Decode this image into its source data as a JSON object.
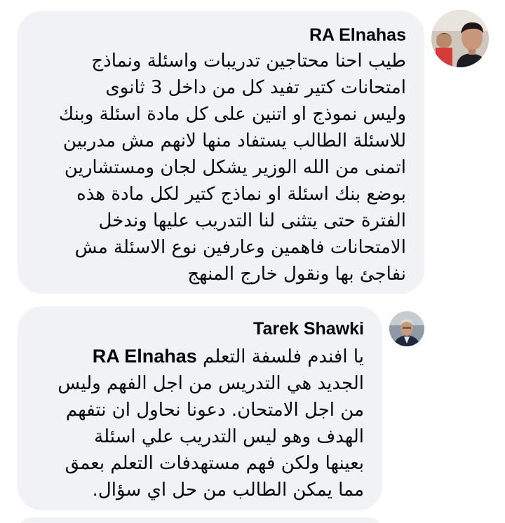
{
  "comments": [
    {
      "author": "RA Elnahas",
      "avatar_icon": "profile-photo-young-man",
      "lines": [
        "طيب احنا محتاجين تدريبات واسئلة ونماذج",
        "امتحانات كتير تفيد كل من داخل 3 ثانوى",
        "وليس نموذج او اتنين على كل مادة اسئلة وبنك",
        "للاسئلة الطالب يستفاد منها لانهم مش مدربين",
        "اتمنى من الله الوزير يشكل لجان ومستشارين",
        "بوضع بنك اسئلة او نماذج كتير لكل مادة هذه",
        "الفترة حتى يتثنى لنا التدريب عليها وندخل",
        "الامتحانات فاهمين وعارفين نوع الاسئلة مش",
        "نفاجئ بها ونقول خارج المنهج"
      ]
    },
    {
      "author": "Tarek Shawki",
      "avatar_icon": "profile-photo-older-man",
      "mention": "RA Elnahas",
      "first_line_rest": "يا افندم فلسفة التعلم",
      "lines": [
        "الجديد هي التدريس من اجل الفهم وليس",
        "من اجل الامتحان. دعونا نحاول ان نتفهم",
        "الهدف وهو ليس التدريب علي اسئلة",
        "بعينها ولكن فهم مستهدفات التعلم بعمق",
        "مما يمكن الطالب من حل اي سؤال."
      ]
    }
  ],
  "colors": {
    "bubble_bg": "#f0f2f5",
    "text": "#050505"
  }
}
